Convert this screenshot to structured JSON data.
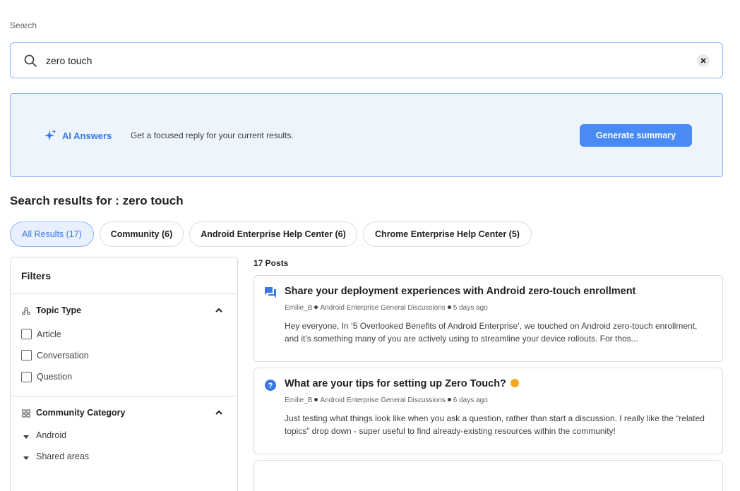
{
  "search": {
    "label": "Search",
    "value": "zero touch",
    "icon": "search-icon",
    "clear_icon": "close-icon"
  },
  "ai": {
    "icon": "sparkle-icon",
    "title": "AI Answers",
    "description": "Get a focused reply for your current results.",
    "button": "Generate summary",
    "accent": "#4a8af4"
  },
  "results": {
    "heading": "Search results for : zero touch"
  },
  "chips": [
    {
      "label": "All Results (17)",
      "active": true
    },
    {
      "label": "Community (6)",
      "active": false
    },
    {
      "label": "Android Enterprise Help Center (6)",
      "active": false
    },
    {
      "label": "Chrome Enterprise Help Center (5)",
      "active": false
    }
  ],
  "filters": {
    "title": "Filters",
    "topic_type": {
      "title": "Topic Type",
      "icon": "topic-type-icon",
      "options": [
        "Article",
        "Conversation",
        "Question"
      ]
    },
    "community_category": {
      "title": "Community Category",
      "icon": "category-grid-icon",
      "items": [
        "Android",
        "Shared areas"
      ]
    }
  },
  "posts": {
    "count_label": "17 Posts",
    "items": [
      {
        "icon": "discussion-icon",
        "title": "Share your deployment experiences with Android zero-touch enrollment",
        "author": "Emilie_B",
        "category": "Android Enterprise General Discussions",
        "time": "5 days ago",
        "excerpt": "Hey everyone, In ‘5 Overlooked Benefits of Android Enterprise’, we touched on Android zero-touch enrollment, and it’s something many of you are actively using to streamline your device rollouts. For thos..."
      },
      {
        "icon": "question-icon",
        "title": "What are your tips for setting up Zero Touch?",
        "author": "Emilie_B",
        "category": "Android Enterprise General Discussions",
        "time": "6 days ago",
        "excerpt": "Just testing what things look like when you ask a question, rather than start a discussion. I really like the “related topics” drop down - super useful to find already-existing resources within the community!"
      }
    ]
  }
}
